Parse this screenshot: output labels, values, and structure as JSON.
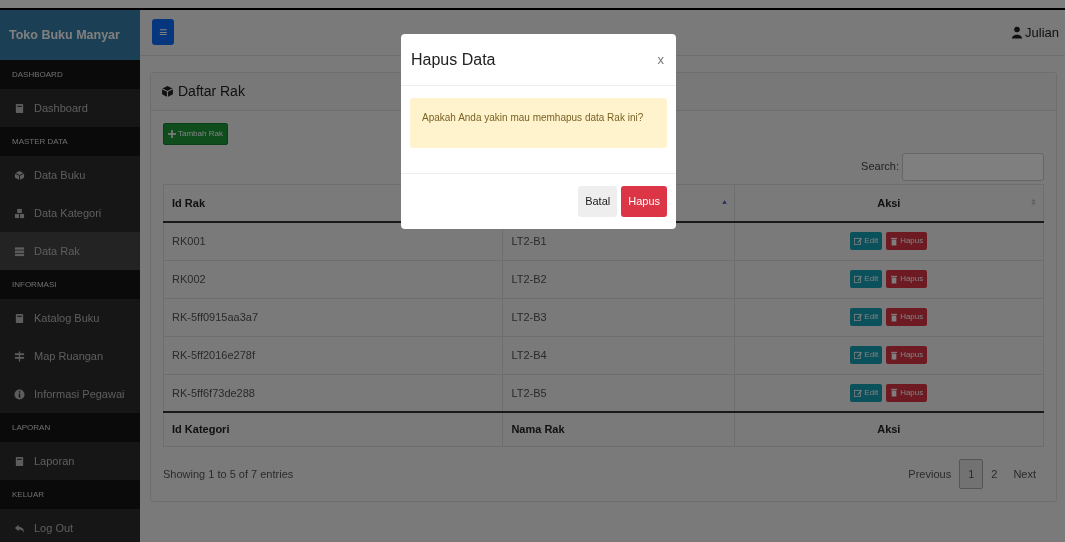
{
  "brand": "Toko Buku Manyar",
  "menu_button": "≡",
  "user": "Julian",
  "sidebar": [
    {
      "kind": "header",
      "label": "DASHBOARD"
    },
    {
      "kind": "item",
      "label": "Dashboard",
      "selected": false
    },
    {
      "kind": "header",
      "label": "MASTER DATA"
    },
    {
      "kind": "item",
      "label": "Data Buku",
      "selected": false
    },
    {
      "kind": "item",
      "label": "Data Kategori",
      "selected": false
    },
    {
      "kind": "item",
      "label": "Data Rak",
      "selected": true
    },
    {
      "kind": "header",
      "label": "INFORMASI"
    },
    {
      "kind": "item",
      "label": "Katalog Buku",
      "selected": false
    },
    {
      "kind": "item",
      "label": "Map Ruangan",
      "selected": false
    },
    {
      "kind": "item",
      "label": "Informasi Pegawai",
      "selected": false
    },
    {
      "kind": "header",
      "label": "LAPORAN"
    },
    {
      "kind": "item",
      "label": "Laporan",
      "selected": false
    },
    {
      "kind": "header",
      "label": "KELUAR"
    },
    {
      "kind": "item",
      "label": "Log Out",
      "selected": false
    }
  ],
  "card": {
    "title": "Daftar Rak",
    "add_button": "Tambah Rak",
    "search_label": "Search:",
    "table": {
      "columns": [
        {
          "label": "Id Rak"
        },
        {
          "sorted": true
        },
        {
          "label": "Aksi",
          "sorted": false
        }
      ],
      "rows": [
        {
          "cells": [
            "RK001",
            "LT2-B1"
          ],
          "actions": [
            "Edit",
            "Hapus"
          ]
        },
        {
          "cells": [
            "RK002",
            "LT2-B2"
          ],
          "actions": [
            "Edit",
            "Hapus"
          ]
        },
        {
          "cells": [
            "RK-5ff0915aa3a7",
            "LT2-B3"
          ],
          "actions": [
            "Edit",
            "Hapus"
          ]
        },
        {
          "cells": [
            "RK-5ff2016e278f",
            "LT2-B4"
          ],
          "actions": [
            "Edit",
            "Hapus"
          ]
        },
        {
          "cells": [
            "RK-5ff6f73de288",
            "LT2-B5"
          ],
          "actions": [
            "Edit",
            "Hapus"
          ]
        }
      ],
      "footer": [
        "Id Kategori",
        "Nama Rak",
        "Aksi"
      ]
    },
    "info": "Showing 1 to 5 of 7 entries",
    "pagination": [
      {
        "label": "Previous",
        "selected": false
      },
      {
        "label": "1",
        "selected": true
      },
      {
        "label": "2",
        "selected": false
      },
      {
        "label": "Next",
        "selected": false
      }
    ]
  },
  "modal": {
    "title": "Hapus Data",
    "close": "x",
    "message": "Apakah Anda yakin mau memhapus data Rak ini?",
    "buttons": [
      {
        "label": "Batal",
        "kind": "secondary"
      },
      {
        "label": "Hapus",
        "kind": "danger"
      }
    ]
  }
}
